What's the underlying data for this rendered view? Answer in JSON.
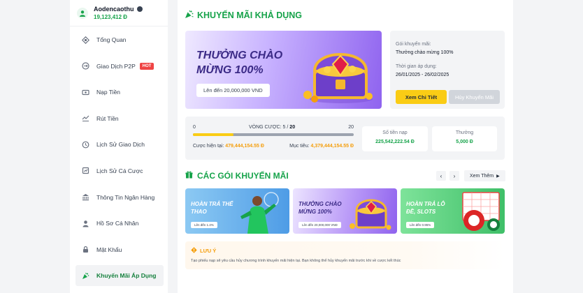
{
  "user": {
    "name": "Aodencaothu",
    "balance": "19,123,412 Đ"
  },
  "menu": [
    {
      "label": "Tổng Quan",
      "icon": "dashboard-icon"
    },
    {
      "label": "Giao Dịch P2P",
      "icon": "p2p-icon",
      "badge": "HOT"
    },
    {
      "label": "Nạp Tiền",
      "icon": "deposit-icon"
    },
    {
      "label": "Rút Tiền",
      "icon": "withdraw-icon"
    },
    {
      "label": "Lịch Sử Giao Dịch",
      "icon": "transaction-history-icon"
    },
    {
      "label": "Lịch Sử Cá Cược",
      "icon": "bet-history-icon"
    },
    {
      "label": "Thông Tin Ngân Hàng",
      "icon": "bank-icon"
    },
    {
      "label": "Hồ Sơ Cá Nhân",
      "icon": "profile-icon"
    },
    {
      "label": "Mật Khẩu",
      "icon": "lock-icon"
    },
    {
      "label": "Khuyến Mãi Áp Dụng",
      "icon": "promotion-icon",
      "active": true
    }
  ],
  "page_title": "KHUYẾN MÃI KHẢ DỤNG",
  "banner": {
    "title": "THƯỞNG CHÀO MỪNG 100%",
    "pill": "Lên đến 20,000,000 VND"
  },
  "info": {
    "promo_label": "Gói khuyến mãi:",
    "promo_value": "Thưởng chào mừng 100%",
    "time_label": "Thời gian áp dụng:",
    "time_value": "26/01/2025 - 26/02/2025",
    "detail_button": "Xem Chi Tiết",
    "cancel_button": "Hủy Khuyến Mãi"
  },
  "wager": {
    "min": "0",
    "max": "20",
    "label": "VÒNG CƯỢC:",
    "current": "5",
    "total": "20",
    "progress": 0.25,
    "current_bet_label": "Cược hiện tại:",
    "current_bet_value": "479,444,154.55 Đ",
    "target_label": "Mục tiêu:",
    "target_value": "4,379,444,154.55 Đ"
  },
  "stats": [
    {
      "label": "Số tiền nạp",
      "value": "225,542,222.54 Đ"
    },
    {
      "label": "Thưởng",
      "value": "5,000 Đ"
    }
  ],
  "packages": {
    "title": "CÁC GÓI KHUYẾN MÃI",
    "see_more": "Xem Thêm",
    "cards": [
      {
        "title": "HOÀN TRẢ THỂ THAO",
        "pill": "Lên đến 1.4%",
        "color": "#6fb4ee"
      },
      {
        "title": "THƯỞNG CHÀO MỪNG 100%",
        "pill": "Lên đến 20,000,000 VNĐ",
        "color": "#a98bf5"
      },
      {
        "title": "HOÀN TRẢ LÔ ĐỀ, SLOTS",
        "pill": "Lên đến 0.95%",
        "color": "#5fd07f"
      }
    ]
  },
  "note": {
    "title": "LƯU Ý",
    "text": "Tạo phiếu nạp sẽ yêu cầu hủy chương trình khuyến mãi hiện tại. Bạn không thể hủy khuyến mãi trước khi về cược kết thúc"
  }
}
